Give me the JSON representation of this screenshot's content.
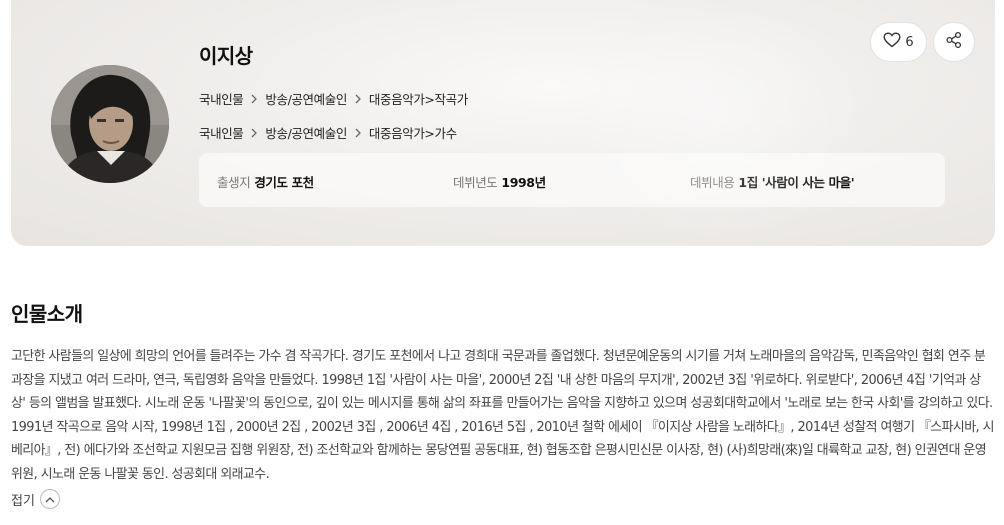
{
  "profile": {
    "name": "이지상",
    "breadcrumbs": [
      {
        "items": [
          "국내인물",
          "방송/공연예술인",
          "대중음악가>작곡가"
        ]
      },
      {
        "items": [
          "국내인물",
          "방송/공연예술인",
          "대중음악가>가수"
        ]
      }
    ],
    "info": [
      {
        "label": "출생지",
        "value": "경기도 포천"
      },
      {
        "label": "데뷔년도",
        "value": "1998년"
      },
      {
        "label": "데뷔내용",
        "value": "1집 '사람이 사는 마을'"
      }
    ],
    "like_count": "6",
    "icons": {
      "like": "heart-icon",
      "share": "share-icon",
      "separator": "chevron-right-icon",
      "collapse": "chevron-up-icon"
    }
  },
  "intro": {
    "title": "인물소개",
    "text": "고단한 사람들의 일상에 희망의 언어를 들려주는 가수 겸 작곡가다. 경기도 포천에서 나고 경희대 국문과를 졸업했다. 청년문예운동의 시기를 거쳐 노래마을의 음악감독, 민족음악인 협회 연주 분과장을 지냈고 여러 드라마, 연극, 독립영화 음악을 만들었다. 1998년 1집 '사람이 사는 마을', 2000년 2집 '내 상한 마음의 무지개', 2002년 3집 '위로하다. 위로받다', 2006년 4집 '기억과 상상' 등의 앨범을 발표했다. 시노래 운동 '나팔꽃'의 동인으로, 깊이 있는 메시지를 통해 삶의 좌표를 만들어가는 음악을 지향하고 있으며 성공회대학교에서 '노래로 보는 한국 사회'를 강의하고 있다. 1991년 작곡으로 음악 시작, 1998년 1집 , 2000년 2집 , 2002년 3집 , 2006년 4집 , 2016년 5집 , 2010년 철학 에세이 『이지상 사람을 노래하다』, 2014년 성찰적 여행기 『스파시바, 시베리아』, 전) 에다가와 조선학교 지원모금 집행 위원장, 전) 조선학교와 함께하는 몽당연필 공동대표, 현) 협동조합 은평시민신문 이사장, 현) (사)희망래(來)일 대륙학교 교장, 현) 인권연대 운영위원, 시노래 운동 나팔꽃 동인. 성공회대 외래교수.",
    "collapse_label": "접기"
  }
}
